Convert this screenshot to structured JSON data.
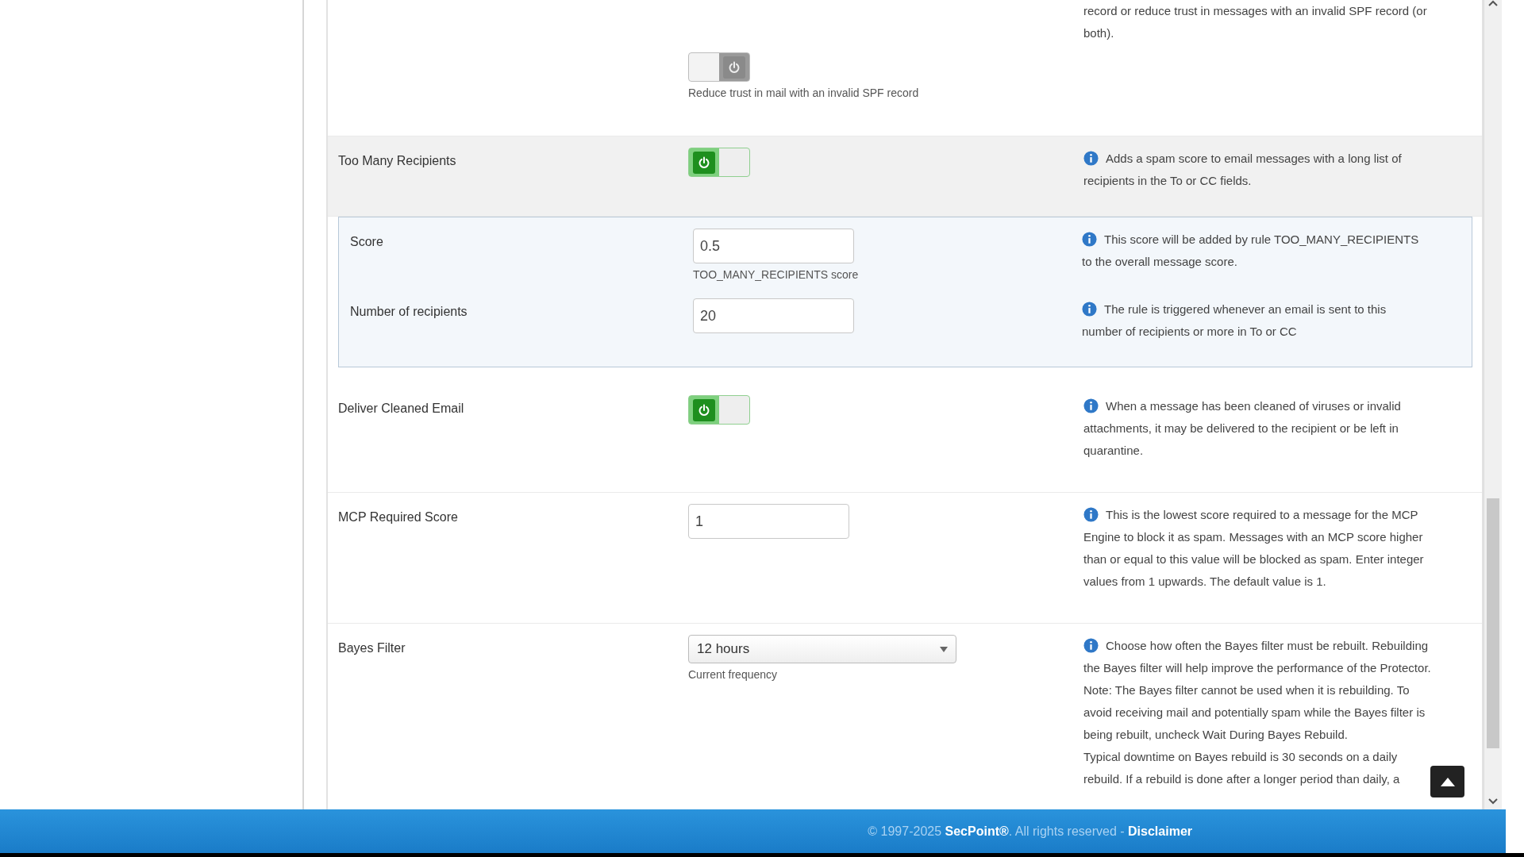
{
  "settings": [
    {
      "kind": "toggle",
      "on": false,
      "hint": "Reduce trust in mail with an invalid SPF record",
      "info_icon": false,
      "shaded": false,
      "description": [
        "record or reduce trust in messages with an invalid SPF record (or both)."
      ]
    },
    {
      "kind": "toggle",
      "label": "Too Many Recipients",
      "on": true,
      "info_icon": true,
      "shaded": true,
      "description": [
        "Adds a spam score to email messages with a long list of recipients in the To or CC fields."
      ],
      "subsettings": [
        {
          "label": "Score",
          "value": "0.5",
          "hint": "TOO_MANY_RECIPIENTS score",
          "description": "This score will be added by rule TOO_MANY_RECIPIENTS to the overall message score."
        },
        {
          "label": "Number of recipients",
          "value": "20",
          "description": "The rule is triggered whenever an email is sent to this number of recipients or more in To or CC"
        }
      ]
    },
    {
      "kind": "toggle",
      "label": "Deliver Cleaned Email",
      "on": true,
      "info_icon": true,
      "shaded": false,
      "description": [
        "When a message has been cleaned of viruses or invalid attachments, it may be delivered to the recipient or be left in quarantine."
      ]
    },
    {
      "kind": "input",
      "label": "MCP Required Score",
      "value": "1",
      "info_icon": true,
      "shaded": false,
      "description": [
        "This is the lowest score required to a message for the MCP Engine to block it as spam. Messages with an MCP score higher than or equal to this value will be blocked as spam. Enter integer values from 1 upwards. The default value is 1."
      ]
    },
    {
      "kind": "select",
      "label": "Bayes Filter",
      "value": "12 hours",
      "hint": "Current frequency",
      "info_icon": true,
      "shaded": false,
      "description": [
        "Choose how often the Bayes filter must be rebuilt. Rebuilding the Bayes filter will help improve the performance of the Protector. Note: The Bayes filter cannot be used when it is rebuilding. To avoid receiving mail and potentially spam while the Bayes filter is being rebuilt, uncheck Wait During Bayes Rebuild.",
        "Typical downtime on Bayes rebuild is 30 seconds on a daily rebuild. If a rebuild is done after a longer period than daily, a"
      ]
    }
  ],
  "footer": {
    "copyright": "© 1997-2025 **SecPoint®**. All rights reserved - ",
    "link": "Disclaimer"
  }
}
